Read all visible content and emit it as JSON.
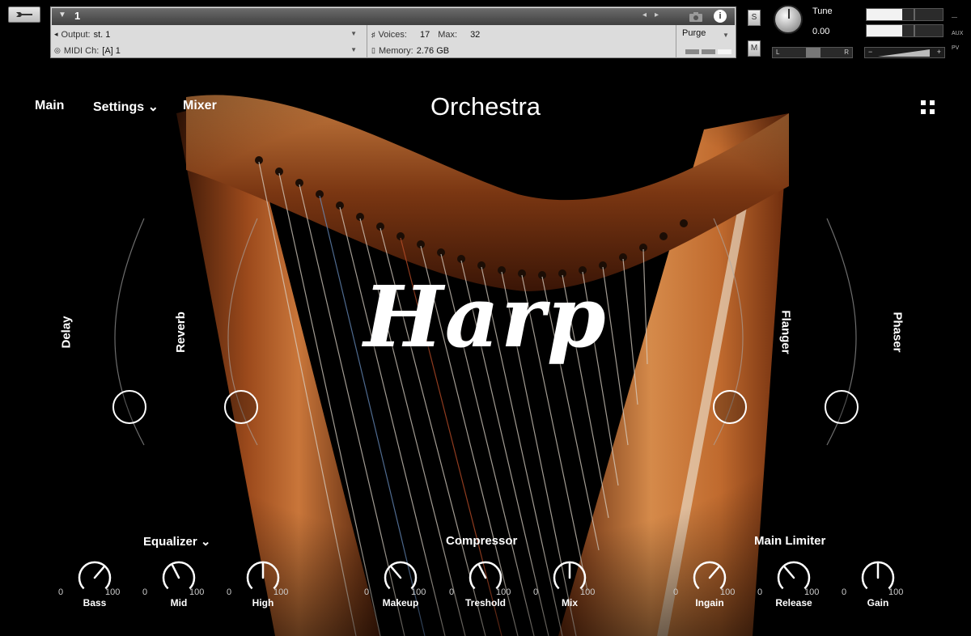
{
  "header": {
    "instrument_number": "1",
    "output_label": "Output:",
    "output_value": "st. 1",
    "midi_label": "MIDI Ch:",
    "midi_value": "[A]  1",
    "voices_label": "Voices:",
    "voices_value": "17",
    "max_label": "Max:",
    "max_value": "32",
    "memory_label": "Memory:",
    "memory_value": "2.76 GB",
    "purge_label": "Purge",
    "solo_label": "S",
    "mute_label": "M",
    "tune_label": "Tune",
    "tune_value": "0.00",
    "pan_left": "L",
    "pan_right": "R",
    "vol_minus": "−",
    "vol_plus": "+",
    "aux_label": "AUX",
    "pv_label": "PV",
    "info_label": "i"
  },
  "nav": {
    "main": "Main",
    "settings": "Settings ⌄",
    "mixer": "Mixer"
  },
  "title": "Orchestra",
  "logo_text": "Harp",
  "fx": {
    "delay": "Delay",
    "reverb": "Reverb",
    "flanger": "Flanger",
    "phaser": "Phaser"
  },
  "sections": {
    "equalizer": "Equalizer ⌄",
    "compressor": "Compressor",
    "limiter": "Main Limiter"
  },
  "knobs": [
    {
      "name": "Bass",
      "min": "0",
      "max": "100",
      "value": 65
    },
    {
      "name": "Mid",
      "min": "0",
      "max": "100",
      "value": 40
    },
    {
      "name": "High",
      "min": "0",
      "max": "100",
      "value": 50
    },
    {
      "name": "Makeup",
      "min": "0",
      "max": "100",
      "value": 35
    },
    {
      "name": "Treshold",
      "min": "0",
      "max": "100",
      "value": 40
    },
    {
      "name": "Mix",
      "min": "0",
      "max": "100",
      "value": 50
    },
    {
      "name": "Ingain",
      "min": "0",
      "max": "100",
      "value": 65
    },
    {
      "name": "Release",
      "min": "0",
      "max": "100",
      "value": 35
    },
    {
      "name": "Gain",
      "min": "0",
      "max": "100",
      "value": 50
    }
  ],
  "colors": {
    "background": "#000000",
    "wood": "#b8602a",
    "text": "#ffffff"
  }
}
